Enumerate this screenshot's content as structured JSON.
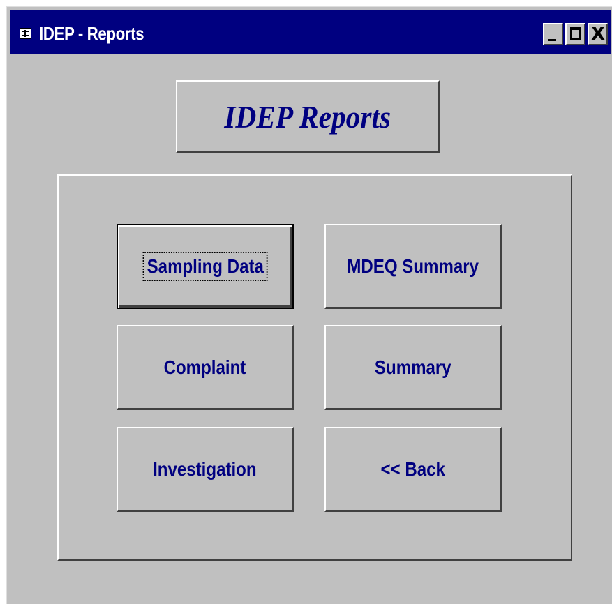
{
  "window": {
    "title": "IDEP - Reports",
    "minimize_icon": "minimize-icon",
    "maximize_icon": "maximize-icon",
    "close_icon": "close-icon",
    "close_glyph": "X"
  },
  "form": {
    "heading": "IDEP Reports",
    "buttons": {
      "sampling_data": "Sampling Data",
      "mdeq_summary": "MDEQ Summary",
      "complaint": "Complaint",
      "summary": "Summary",
      "investigation": "Investigation",
      "back": "<< Back"
    }
  },
  "colors": {
    "titlebar": "#000080",
    "face": "#c0c0c0",
    "label_text": "#000080"
  }
}
